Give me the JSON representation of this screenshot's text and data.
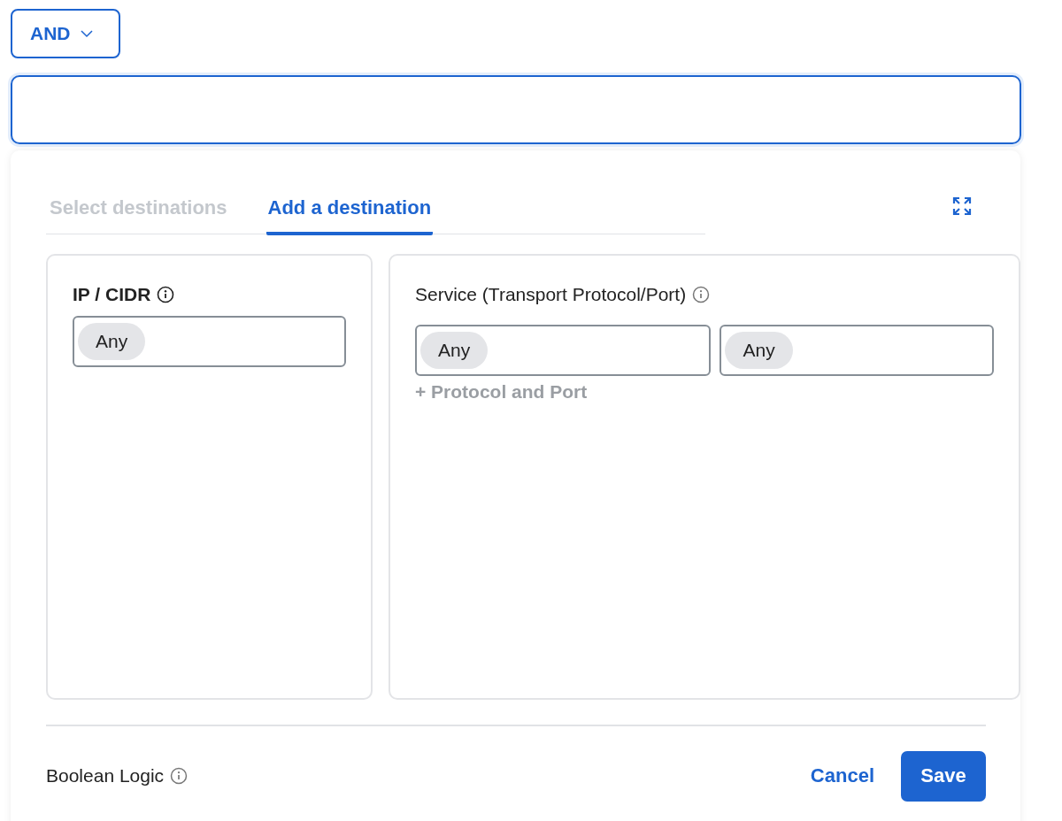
{
  "operator_dropdown": {
    "label": "AND"
  },
  "tabs": [
    {
      "label": "Select destinations",
      "selected": false
    },
    {
      "label": "Add a destination",
      "selected": true
    }
  ],
  "ip_section": {
    "title": "IP / CIDR",
    "chips": [
      "Any"
    ]
  },
  "service_section": {
    "title": "Service (Transport Protocol/Port)",
    "fields": [
      {
        "chips": [
          "Any"
        ]
      },
      {
        "chips": [
          "Any"
        ]
      }
    ],
    "add_link": "+ Protocol and Port"
  },
  "footer": {
    "label": "Boolean Logic",
    "cancel": "Cancel",
    "save": "Save"
  }
}
